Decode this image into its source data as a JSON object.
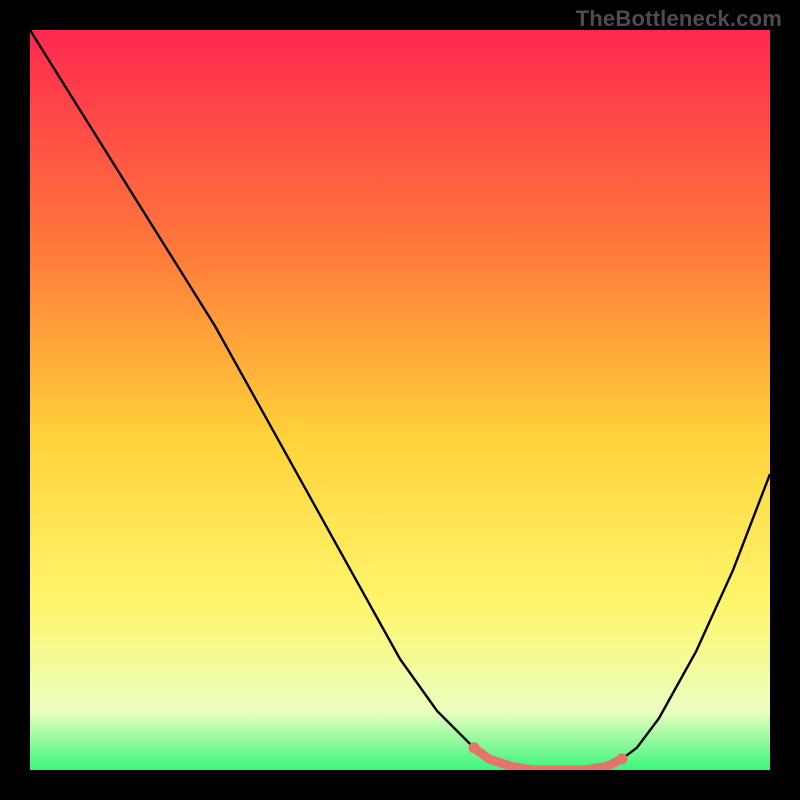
{
  "watermark": "TheBottleneck.com",
  "chart_data": {
    "type": "line",
    "title": "",
    "xlabel": "",
    "ylabel": "",
    "xlim": [
      0,
      100
    ],
    "ylim": [
      0,
      100
    ],
    "grid": false,
    "x": [
      0,
      5,
      10,
      15,
      20,
      25,
      30,
      35,
      40,
      45,
      50,
      55,
      60,
      62,
      65,
      68,
      72,
      75,
      78,
      80,
      82,
      85,
      90,
      95,
      100
    ],
    "values": [
      100,
      92,
      84,
      76,
      68,
      60,
      51,
      42,
      33,
      24,
      15,
      8,
      3,
      1.5,
      0.5,
      0,
      0,
      0,
      0.5,
      1.5,
      3,
      7,
      16,
      27,
      40
    ],
    "highlight_x_range": [
      60,
      80
    ],
    "highlight_color": "#e6746d",
    "curve_color": "#000000",
    "background_gradient": {
      "top": "#ff2850",
      "mid1": "#ff7a3a",
      "mid2": "#ffd23a",
      "mid3": "#fff66e",
      "mid4": "#eaffbf",
      "bottom": "#3cf57a"
    }
  }
}
